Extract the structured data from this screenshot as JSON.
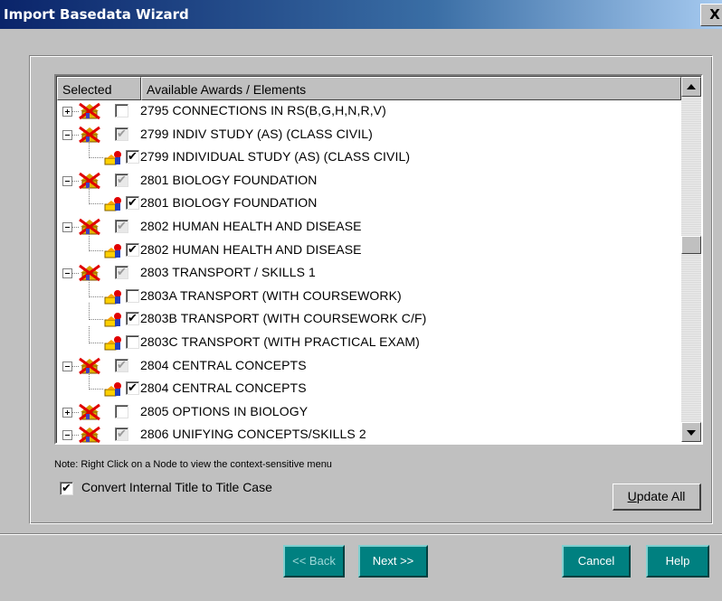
{
  "window": {
    "title": "Import Basedata Wizard",
    "close_glyph": "X"
  },
  "tree": {
    "columns": {
      "selected": "Selected",
      "available": "Available Awards / Elements"
    },
    "rows": [
      {
        "level": 0,
        "expander": "plus",
        "checked": false,
        "grey": false,
        "label": "2795 CONNECTIONS IN RS(B,G,H,N,R,V)"
      },
      {
        "level": 0,
        "expander": "minus",
        "checked": true,
        "grey": true,
        "label": "2799 INDIV STUDY (AS) (CLASS CIVIL)"
      },
      {
        "level": 1,
        "expander": null,
        "checked": true,
        "grey": false,
        "label": "2799 INDIVIDUAL STUDY (AS) (CLASS CIVIL)"
      },
      {
        "level": 0,
        "expander": "minus",
        "checked": true,
        "grey": true,
        "label": "2801 BIOLOGY FOUNDATION"
      },
      {
        "level": 1,
        "expander": null,
        "checked": true,
        "grey": false,
        "label": "2801 BIOLOGY FOUNDATION"
      },
      {
        "level": 0,
        "expander": "minus",
        "checked": true,
        "grey": true,
        "label": "2802 HUMAN HEALTH AND DISEASE"
      },
      {
        "level": 1,
        "expander": null,
        "checked": true,
        "grey": false,
        "label": "2802 HUMAN HEALTH AND DISEASE"
      },
      {
        "level": 0,
        "expander": "minus",
        "checked": true,
        "grey": true,
        "label": "2803 TRANSPORT / SKILLS 1"
      },
      {
        "level": 1,
        "expander": null,
        "checked": false,
        "grey": false,
        "label": "2803A TRANSPORT (WITH COURSEWORK)"
      },
      {
        "level": 1,
        "expander": null,
        "checked": true,
        "grey": false,
        "label": "2803B TRANSPORT (WITH COURSEWORK C/F)"
      },
      {
        "level": 1,
        "expander": null,
        "checked": false,
        "grey": false,
        "label": "2803C TRANSPORT (WITH PRACTICAL EXAM)"
      },
      {
        "level": 0,
        "expander": "minus",
        "checked": true,
        "grey": true,
        "label": "2804 CENTRAL CONCEPTS"
      },
      {
        "level": 1,
        "expander": null,
        "checked": true,
        "grey": false,
        "label": "2804 CENTRAL CONCEPTS"
      },
      {
        "level": 0,
        "expander": "plus",
        "checked": false,
        "grey": false,
        "label": "2805 OPTIONS IN BIOLOGY"
      },
      {
        "level": 0,
        "expander": "minus",
        "checked": true,
        "grey": true,
        "label": "2806 UNIFYING CONCEPTS/SKILLS 2"
      }
    ]
  },
  "note": "Note: Right Click on a Node to view the context-sensitive menu",
  "convert_option": {
    "label": "Convert Internal Title to Title Case",
    "checked": true,
    "check_glyph": "✔"
  },
  "update_all": {
    "prefix": "U",
    "rest": "pdate All"
  },
  "buttons": {
    "back": "<< Back",
    "next": "Next >>",
    "cancel": "Cancel",
    "help": "Help"
  },
  "check_glyph": "✔",
  "colors": {
    "teal_button": "#008080",
    "window_bg": "#c0c0c0",
    "titlebar": "#0a246a"
  }
}
